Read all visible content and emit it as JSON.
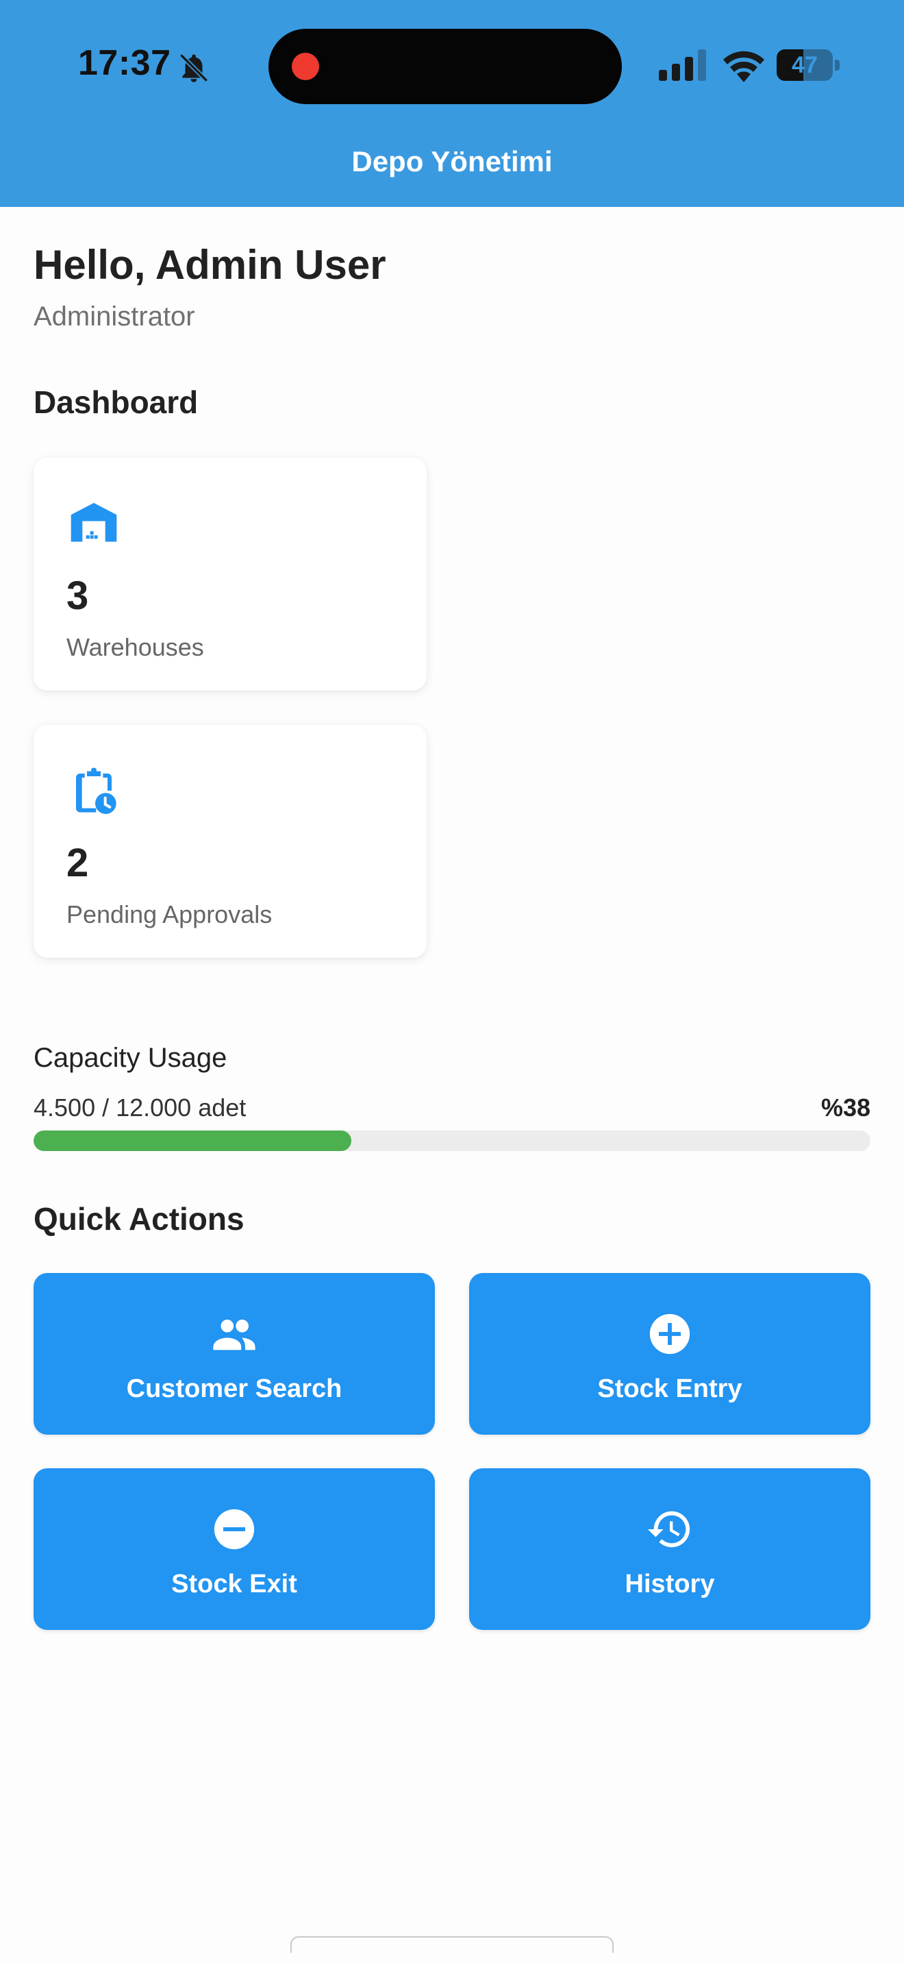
{
  "status_bar": {
    "time": "17:37",
    "battery": "47",
    "icons": [
      "bell-off-icon",
      "record-dot-icon",
      "signal-icon",
      "wifi-icon",
      "battery-icon"
    ]
  },
  "header": {
    "title": "Depo Yönetimi",
    "background_color": "#3a9ae0"
  },
  "user": {
    "greeting": "Hello, Admin User",
    "role": "Administrator"
  },
  "dashboard": {
    "title": "Dashboard",
    "cards": [
      {
        "icon": "warehouse-icon",
        "value": "3",
        "label": "Warehouses"
      },
      {
        "icon": "pending-clipboard-icon",
        "value": "2",
        "label": "Pending Approvals"
      }
    ]
  },
  "capacity": {
    "title": "Capacity Usage",
    "amount_text": "4.500 / 12.000 adet",
    "percent_text": "%38",
    "fraction": 0.38,
    "bar_color": "#4caf50"
  },
  "quick_actions": {
    "title": "Quick Actions",
    "button_color": "#2294f2",
    "items": [
      {
        "icon": "people-icon",
        "label": "Customer Search"
      },
      {
        "icon": "add-circle-icon",
        "label": "Stock Entry"
      },
      {
        "icon": "remove-circle-icon",
        "label": "Stock Exit"
      },
      {
        "icon": "history-icon",
        "label": "History"
      }
    ]
  }
}
